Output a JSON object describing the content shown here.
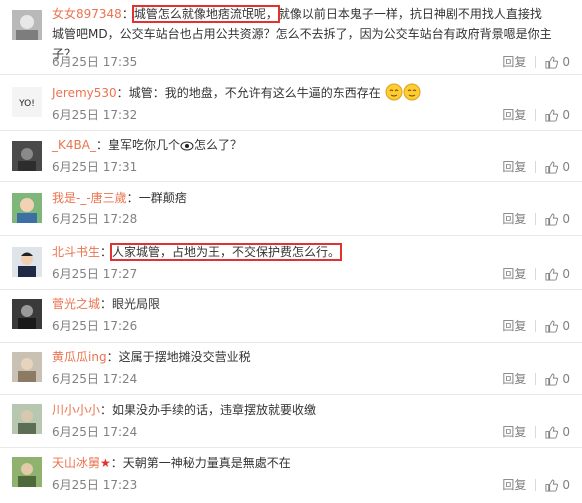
{
  "reply_label": "回复",
  "like_count": "0",
  "comments": [
    {
      "user": "女女897348",
      "sep": "：",
      "content_hl": "城管怎么就像地痞流氓呢，",
      "content": "就像以前日本鬼子一样，抗日神剧不用找人直接找城管吧MD，公交车站台也占用公共资源？怎么不去拆了，因为公交车站台有政府背景嗯是你主子？",
      "time": "6月25日 17:35"
    },
    {
      "user": "Jeremy530",
      "sep": "：",
      "content": "城管：我的地盘，不允许有这么牛逼的东西存在",
      "time": "6月25日 17:32"
    },
    {
      "user": "_K4BA_",
      "sep": "：",
      "content_a": "皇军吃你几个",
      "content_b": "怎么了？",
      "time": "6月25日 17:31"
    },
    {
      "user": "我是-_-唐三歲",
      "sep": "：",
      "content": "一群颠痞",
      "time": "6月25日 17:28"
    },
    {
      "user": "北斗书生",
      "sep": "：",
      "content_hl": "人家城管，占地为王，不交保护费怎么行。",
      "time": "6月25日 17:27"
    },
    {
      "user": "菅光之城",
      "sep": "：",
      "content": "眼光局限",
      "time": "6月25日 17:26"
    },
    {
      "user": "黄瓜瓜ing",
      "sep": "：",
      "content": "这属于摆地摊没交营业税",
      "time": "6月25日 17:24"
    },
    {
      "user": "川小小小",
      "sep": "：",
      "content": "如果没办手续的话，违章摆放就要收缴",
      "time": "6月25日 17:24"
    },
    {
      "user": "天山冰舅",
      "sep": "：",
      "content": "天朝第一神秘力量真是無處不在",
      "time": "6月25日 17:23"
    }
  ]
}
